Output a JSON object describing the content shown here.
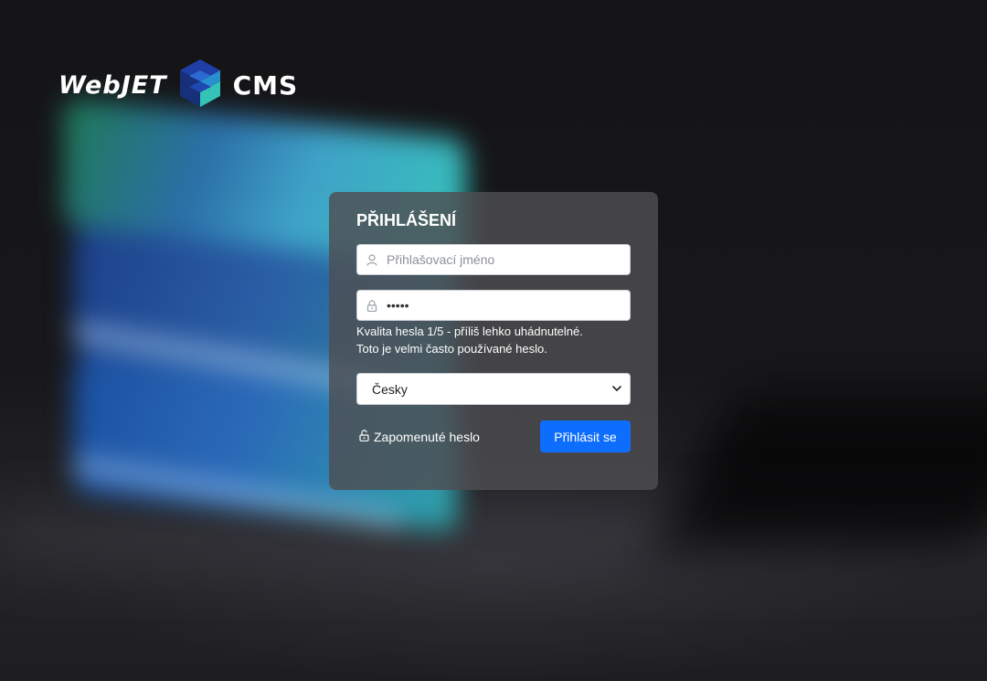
{
  "app": {
    "logo": {
      "left_text": "WebJET",
      "right_text": "CMS",
      "icon": "webjet-cube-logo-icon"
    }
  },
  "login": {
    "title": "PŘIHLÁŠENÍ",
    "username": {
      "placeholder": "Přihlašovací jméno",
      "value": "",
      "icon": "user-icon"
    },
    "password": {
      "placeholder": "",
      "value": "•••••",
      "icon": "lock-icon"
    },
    "password_quality": {
      "line1": "Kvalita hesla 1/5 - příliš lehko uhádnutelné.",
      "line2": "Toto je velmi často používané heslo."
    },
    "language": {
      "selected": "Česky",
      "icon": "chevron-down-icon"
    },
    "forgot_password": {
      "label": "Zapomenuté heslo",
      "icon": "unlock-icon"
    },
    "submit_label": "Přihlásit se"
  },
  "colors": {
    "primary_button": "#0d6efd",
    "card_background": "#4e4e52",
    "page_background": "#141417",
    "logo_cube_blue": "#1f3fa6",
    "logo_cube_teal": "#35c3b8"
  }
}
